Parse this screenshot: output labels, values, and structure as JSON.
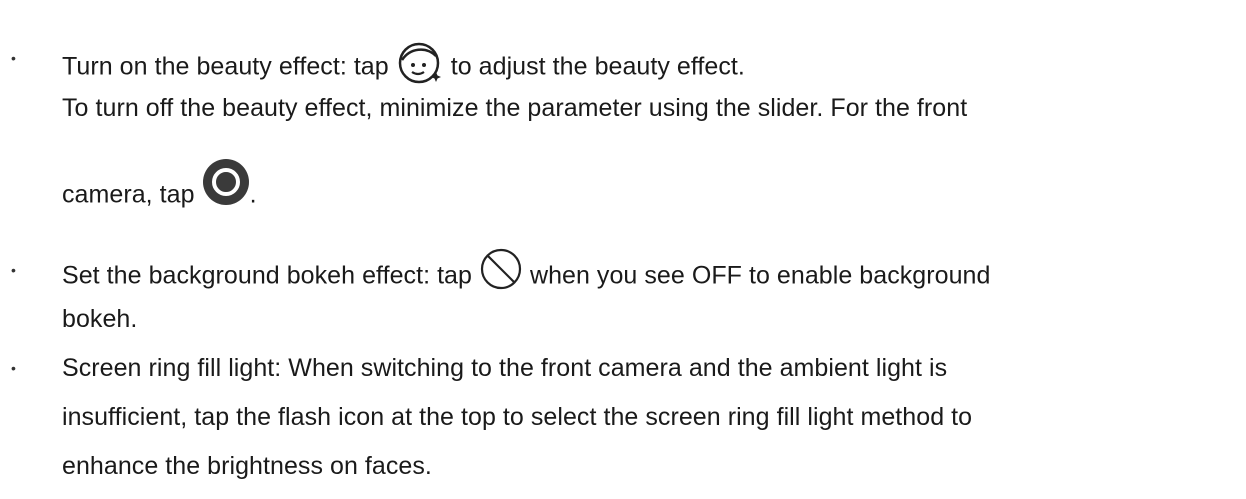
{
  "bullets": [
    {
      "line1_before": "Turn on the beauty effect: tap ",
      "line1_after": " to adjust the beauty effect.",
      "line2": "To turn off the beauty effect, minimize the parameter using the slider. For the front",
      "line3_before": "camera, tap ",
      "line3_after": ".",
      "icons": [
        "beauty-face-icon",
        "record-circle-icon"
      ]
    },
    {
      "line1_before": "Set the background bokeh effect: tap ",
      "line1_after": " when you see OFF to enable background",
      "line2": "bokeh.",
      "icons": [
        "bokeh-off-icon"
      ]
    },
    {
      "line1": "Screen ring fill light: When switching to the front camera and the ambient light is",
      "line2": "insufficient, tap the flash icon at the top to select the screen ring fill light method to",
      "line3": "enhance the brightness on faces."
    }
  ],
  "bullet_glyph": "•"
}
